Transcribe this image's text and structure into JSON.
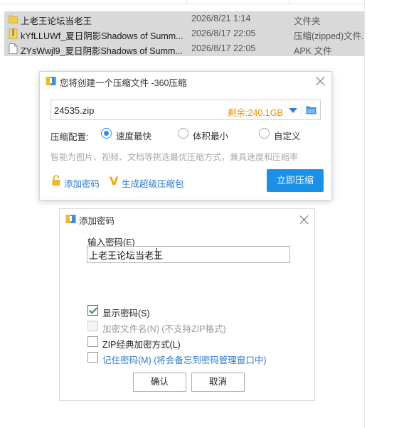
{
  "explorer": {
    "files": [
      {
        "name": "上老王论坛当老王",
        "date": "2026/8/21 1:14",
        "type": "文件夹",
        "icon": "folder-icon"
      },
      {
        "name": "kYfLLUWf_夏日阴影Shadows of Summ...",
        "date": "2026/8/17 22:05",
        "type": "压缩(zipped)文件...",
        "icon": "zip-file-icon"
      },
      {
        "name": "ZYsWwjl9_夏日阴影Shadows of Summ...",
        "date": "2026/8/17 22:05",
        "type": "APK 文件",
        "icon": "apk-file-icon"
      }
    ],
    "colors": {
      "row_selected": "#d9d9d9"
    }
  },
  "compress_dialog": {
    "title": "您将创建一个压缩文件 -360压缩",
    "filename": "24535.zip",
    "remaining": "剩余:240.1GB",
    "config_label": "压缩配置:",
    "options": [
      {
        "label": "速度最快",
        "selected": true
      },
      {
        "label": "体积最小",
        "selected": false
      },
      {
        "label": "自定义",
        "selected": false
      }
    ],
    "hint": "智能为图片、视频、文档等挑选最优压缩方式，兼具速度和压缩率",
    "add_password": "添加密码",
    "super_pack": "生成超级压缩包",
    "compress_button": "立即压缩",
    "colors": {
      "accent": "#1a90e8",
      "remaining": "#f08c00",
      "link": "#2b7bd0"
    }
  },
  "password_dialog": {
    "title": "添加密码",
    "input_label": "输入密码(E)",
    "password_value": "上老王论坛当老王",
    "show_password": {
      "label": "显示密码(S)",
      "checked": true
    },
    "encrypt_names": {
      "label": "加密文件名(N)",
      "note": "(不支持ZIP格式)",
      "checked": false,
      "disabled": true
    },
    "zip_classic": {
      "label": "ZIP经典加密方式(L)",
      "checked": false
    },
    "remember": {
      "label": "记住密码(M)",
      "note": "(将会备忘到密码管理窗口中)",
      "checked": false
    },
    "ok_button": "确认",
    "cancel_button": "取消"
  }
}
